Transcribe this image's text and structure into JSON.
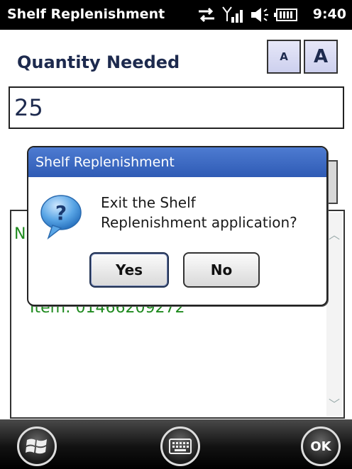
{
  "status_bar": {
    "title": "Shelf Replenishment",
    "time": "9:40",
    "icons": [
      "sync-icon",
      "signal-icon",
      "volume-icon",
      "battery-icon"
    ]
  },
  "header": {
    "label": "Quantity Needed",
    "font_small_label": "A",
    "font_large_label": "A"
  },
  "quantity_input": {
    "value": "25"
  },
  "log": {
    "line1_visible": "N",
    "line2_visible": "Item: 01466209272"
  },
  "dialog": {
    "title": "Shelf Replenishment",
    "message_line1": "Exit the Shelf",
    "message_line2": "Replenishment application?",
    "yes_label": "Yes",
    "no_label": "No",
    "icon": "question-icon"
  },
  "taskbar": {
    "start_icon": "windows-start-icon",
    "keyboard_icon": "keyboard-icon",
    "ok_label": "OK"
  }
}
